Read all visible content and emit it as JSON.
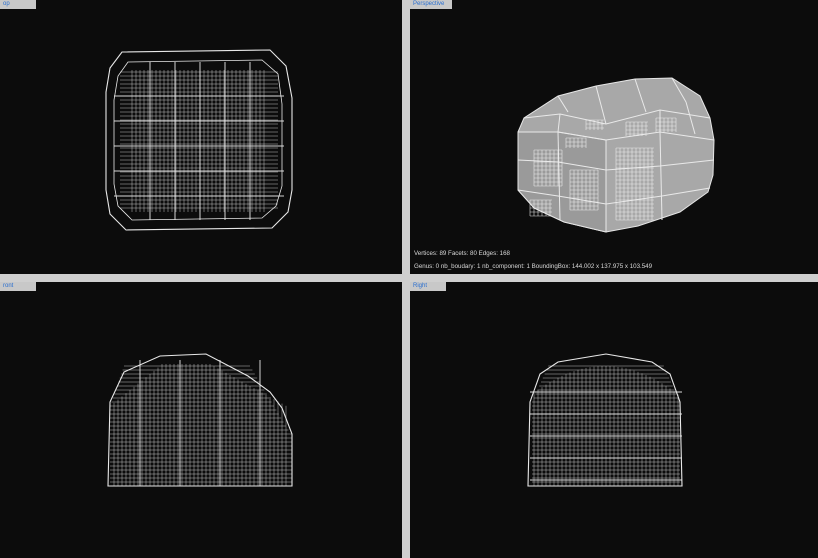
{
  "viewports": {
    "top": {
      "label": "op"
    },
    "perspective": {
      "label": "Perspective"
    },
    "front": {
      "label": "ront"
    },
    "right": {
      "label": "Right"
    }
  },
  "stats": {
    "line1": "Vertices: 89 Facets: 80 Edges: 168",
    "line2": "Genus: 0 nb_boudary: 1 nb_component: 1 BoundingBox: 144.002 x 137.975 x 103.549"
  },
  "colors": {
    "viewport_bg": "#0c0c0c",
    "wire": "#e8e8e8",
    "solid_face": "#a8a8a8",
    "tab_text": "#2a6fd0"
  }
}
